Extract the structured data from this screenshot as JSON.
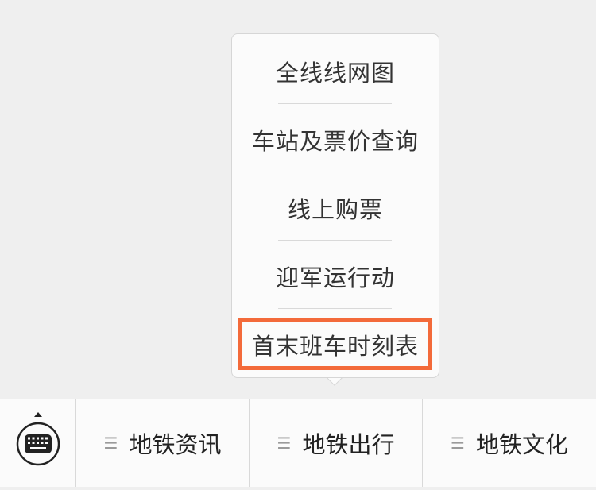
{
  "popup_menu": {
    "items": [
      {
        "label": "全线线网图"
      },
      {
        "label": "车站及票价查询"
      },
      {
        "label": "线上购票"
      },
      {
        "label": "迎军运行动"
      },
      {
        "label": "首末班车时刻表",
        "highlighted": true
      }
    ],
    "highlight_color": "#f36a3a"
  },
  "bottom_menu": {
    "keyboard_icon": "keyboard-icon",
    "menu_icon": "menu-lines-icon",
    "tabs": [
      {
        "label": "地铁资讯"
      },
      {
        "label": "地铁出行",
        "active": true
      },
      {
        "label": "地铁文化"
      }
    ]
  }
}
